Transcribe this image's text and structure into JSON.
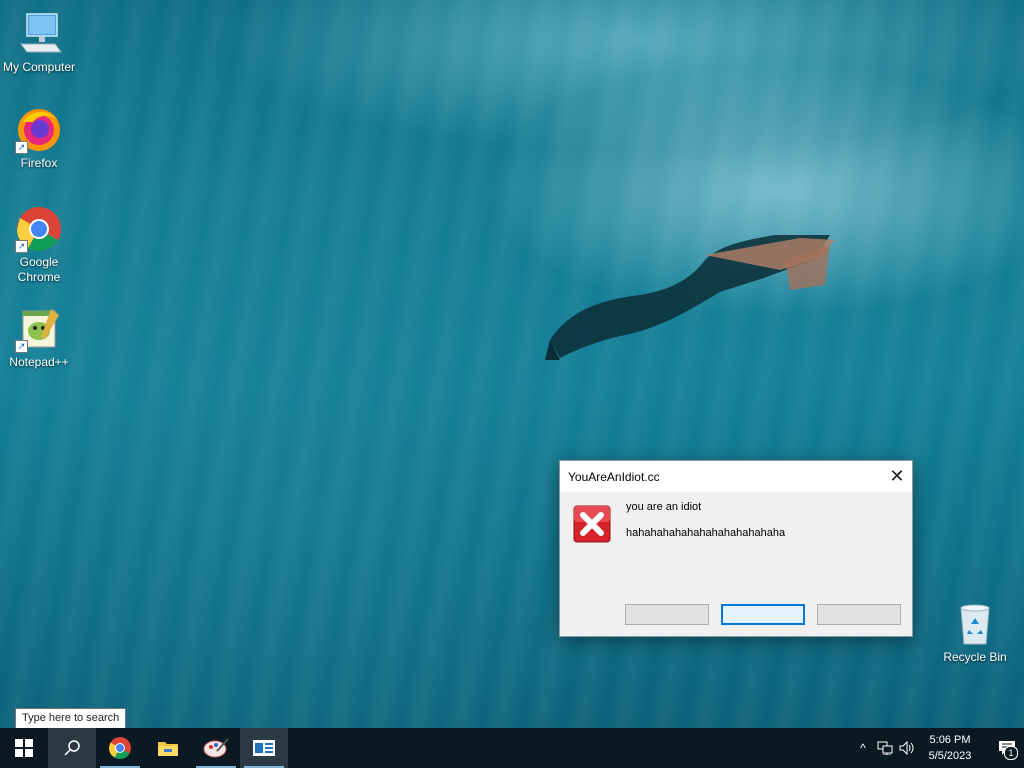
{
  "desktop": {
    "icons": [
      {
        "label": "My Computer",
        "icon": "computer-icon"
      },
      {
        "label": "Firefox",
        "icon": "firefox-icon"
      },
      {
        "label": "Google Chrome",
        "icon": "chrome-icon"
      },
      {
        "label": "Notepad++",
        "icon": "notepadpp-icon"
      },
      {
        "label": "Recycle Bin",
        "icon": "recycle-bin-icon"
      }
    ]
  },
  "dialog": {
    "title": "YouAreAnIdiot.cc",
    "close_glyph": "✕",
    "message_line1": "you are an idiot",
    "message_line2": "hahahahahahahahahahahahaha",
    "buttons": [
      "",
      "",
      ""
    ],
    "focused_button_index": 1,
    "icon": "error-x-icon"
  },
  "taskbar": {
    "search_tooltip": "Type here to search",
    "pinned": [
      "start-icon",
      "search-icon",
      "chrome-icon",
      "file-explorer-icon",
      "paint-icon",
      "app-window-icon"
    ],
    "tray": {
      "time": "5:06 PM",
      "date": "5/5/2023",
      "chevron": "^",
      "notification_count": "1"
    }
  },
  "colors": {
    "accent": "#0078d7",
    "taskbar_bg": "#0b1a22",
    "error_red": "#d9232b"
  }
}
